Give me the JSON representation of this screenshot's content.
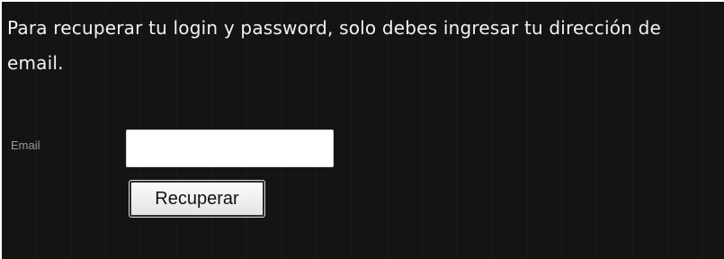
{
  "recovery_form": {
    "intro_text": "Para recuperar tu login y password, solo debes ingresar tu dirección de email.",
    "email_label": "Email",
    "email_value": "",
    "email_placeholder": "",
    "submit_label": "Recuperar"
  }
}
